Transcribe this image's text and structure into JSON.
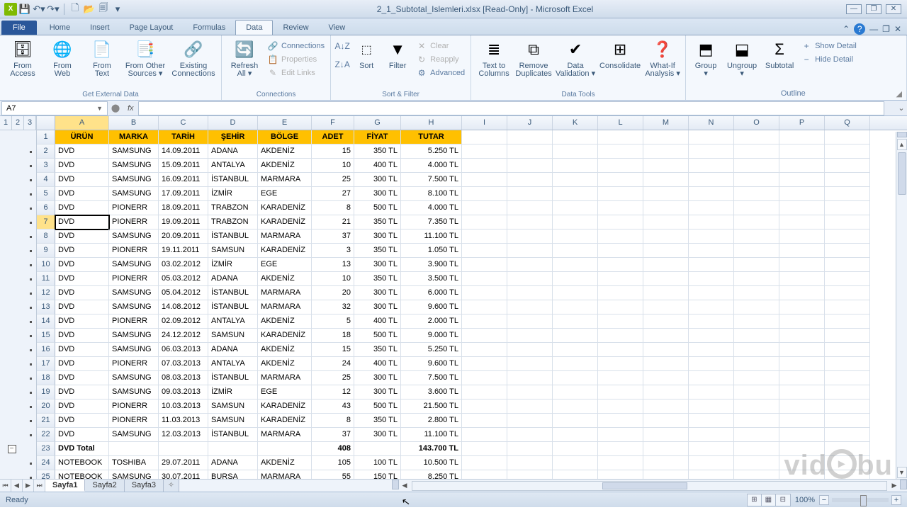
{
  "app": {
    "title": "2_1_Subtotal_Islemleri.xlsx  [Read-Only] - Microsoft Excel"
  },
  "tabs": {
    "file": "File",
    "home": "Home",
    "insert": "Insert",
    "pageLayout": "Page Layout",
    "formulas": "Formulas",
    "data": "Data",
    "review": "Review",
    "view": "View"
  },
  "ribbon": {
    "fromAccess": "From\nAccess",
    "fromWeb": "From\nWeb",
    "fromText": "From\nText",
    "fromOther": "From Other\nSources ▾",
    "existing": "Existing\nConnections",
    "getExternal": "Get External Data",
    "refresh": "Refresh\nAll ▾",
    "connections": "Connections",
    "properties": "Properties",
    "editLinks": "Edit Links",
    "connGroup": "Connections",
    "sort": "Sort",
    "filter": "Filter",
    "clear": "Clear",
    "reapply": "Reapply",
    "advanced": "Advanced",
    "sortFilter": "Sort & Filter",
    "textToCols": "Text to\nColumns",
    "removeDup": "Remove\nDuplicates",
    "dataVal": "Data\nValidation ▾",
    "consolidate": "Consolidate",
    "whatIf": "What-If\nAnalysis ▾",
    "dataTools": "Data Tools",
    "group": "Group\n▾",
    "ungroup": "Ungroup\n▾",
    "subtotal": "Subtotal",
    "showDetail": "Show Detail",
    "hideDetail": "Hide Detail",
    "outline": "Outline"
  },
  "namebox": "A7",
  "outlineLevels": [
    "1",
    "2",
    "3"
  ],
  "colLetters": [
    "A",
    "B",
    "C",
    "D",
    "E",
    "F",
    "G",
    "H",
    "I",
    "J",
    "K",
    "L",
    "M",
    "N",
    "O",
    "P",
    "Q"
  ],
  "headers": {
    "A": "ÜRÜN",
    "B": "MARKA",
    "C": "TARİH",
    "D": "ŞEHİR",
    "E": "BÖLGE",
    "F": "ADET",
    "G": "FİYAT",
    "H": "TUTAR"
  },
  "rows": [
    {
      "n": 2,
      "A": "DVD",
      "B": "SAMSUNG",
      "C": "14.09.2011",
      "D": "ADANA",
      "E": "AKDENİZ",
      "F": "15",
      "G": "350 TL",
      "H": "5.250 TL"
    },
    {
      "n": 3,
      "A": "DVD",
      "B": "SAMSUNG",
      "C": "15.09.2011",
      "D": "ANTALYA",
      "E": "AKDENİZ",
      "F": "10",
      "G": "400 TL",
      "H": "4.000 TL"
    },
    {
      "n": 4,
      "A": "DVD",
      "B": "SAMSUNG",
      "C": "16.09.2011",
      "D": "İSTANBUL",
      "E": "MARMARA",
      "F": "25",
      "G": "300 TL",
      "H": "7.500 TL"
    },
    {
      "n": 5,
      "A": "DVD",
      "B": "SAMSUNG",
      "C": "17.09.2011",
      "D": "İZMİR",
      "E": "EGE",
      "F": "27",
      "G": "300 TL",
      "H": "8.100 TL"
    },
    {
      "n": 6,
      "A": "DVD",
      "B": "PIONERR",
      "C": "18.09.2011",
      "D": "TRABZON",
      "E": "KARADENİZ",
      "F": "8",
      "G": "500 TL",
      "H": "4.000 TL"
    },
    {
      "n": 7,
      "A": "DVD",
      "B": "PIONERR",
      "C": "19.09.2011",
      "D": "TRABZON",
      "E": "KARADENİZ",
      "F": "21",
      "G": "350 TL",
      "H": "7.350 TL",
      "sel": true
    },
    {
      "n": 8,
      "A": "DVD",
      "B": "SAMSUNG",
      "C": "20.09.2011",
      "D": "İSTANBUL",
      "E": "MARMARA",
      "F": "37",
      "G": "300 TL",
      "H": "11.100 TL"
    },
    {
      "n": 9,
      "A": "DVD",
      "B": "PIONERR",
      "C": "19.11.2011",
      "D": "SAMSUN",
      "E": "KARADENİZ",
      "F": "3",
      "G": "350 TL",
      "H": "1.050 TL"
    },
    {
      "n": 10,
      "A": "DVD",
      "B": "SAMSUNG",
      "C": "03.02.2012",
      "D": "İZMİR",
      "E": "EGE",
      "F": "13",
      "G": "300 TL",
      "H": "3.900 TL"
    },
    {
      "n": 11,
      "A": "DVD",
      "B": "PIONERR",
      "C": "05.03.2012",
      "D": "ADANA",
      "E": "AKDENİZ",
      "F": "10",
      "G": "350 TL",
      "H": "3.500 TL"
    },
    {
      "n": 12,
      "A": "DVD",
      "B": "SAMSUNG",
      "C": "05.04.2012",
      "D": "İSTANBUL",
      "E": "MARMARA",
      "F": "20",
      "G": "300 TL",
      "H": "6.000 TL"
    },
    {
      "n": 13,
      "A": "DVD",
      "B": "SAMSUNG",
      "C": "14.08.2012",
      "D": "İSTANBUL",
      "E": "MARMARA",
      "F": "32",
      "G": "300 TL",
      "H": "9.600 TL"
    },
    {
      "n": 14,
      "A": "DVD",
      "B": "PIONERR",
      "C": "02.09.2012",
      "D": "ANTALYA",
      "E": "AKDENİZ",
      "F": "5",
      "G": "400 TL",
      "H": "2.000 TL"
    },
    {
      "n": 15,
      "A": "DVD",
      "B": "SAMSUNG",
      "C": "24.12.2012",
      "D": "SAMSUN",
      "E": "KARADENİZ",
      "F": "18",
      "G": "500 TL",
      "H": "9.000 TL"
    },
    {
      "n": 16,
      "A": "DVD",
      "B": "SAMSUNG",
      "C": "06.03.2013",
      "D": "ADANA",
      "E": "AKDENİZ",
      "F": "15",
      "G": "350 TL",
      "H": "5.250 TL"
    },
    {
      "n": 17,
      "A": "DVD",
      "B": "PIONERR",
      "C": "07.03.2013",
      "D": "ANTALYA",
      "E": "AKDENİZ",
      "F": "24",
      "G": "400 TL",
      "H": "9.600 TL"
    },
    {
      "n": 18,
      "A": "DVD",
      "B": "SAMSUNG",
      "C": "08.03.2013",
      "D": "İSTANBUL",
      "E": "MARMARA",
      "F": "25",
      "G": "300 TL",
      "H": "7.500 TL"
    },
    {
      "n": 19,
      "A": "DVD",
      "B": "SAMSUNG",
      "C": "09.03.2013",
      "D": "İZMİR",
      "E": "EGE",
      "F": "12",
      "G": "300 TL",
      "H": "3.600 TL"
    },
    {
      "n": 20,
      "A": "DVD",
      "B": "PIONERR",
      "C": "10.03.2013",
      "D": "SAMSUN",
      "E": "KARADENİZ",
      "F": "43",
      "G": "500 TL",
      "H": "21.500 TL"
    },
    {
      "n": 21,
      "A": "DVD",
      "B": "PIONERR",
      "C": "11.03.2013",
      "D": "SAMSUN",
      "E": "KARADENİZ",
      "F": "8",
      "G": "350 TL",
      "H": "2.800 TL"
    },
    {
      "n": 22,
      "A": "DVD",
      "B": "SAMSUNG",
      "C": "12.03.2013",
      "D": "İSTANBUL",
      "E": "MARMARA",
      "F": "37",
      "G": "300 TL",
      "H": "11.100 TL"
    },
    {
      "n": 23,
      "A": "DVD Total",
      "B": "",
      "C": "",
      "D": "",
      "E": "",
      "F": "408",
      "G": "",
      "H": "143.700 TL",
      "total": true
    },
    {
      "n": 24,
      "A": "NOTEBOOK",
      "B": "TOSHIBA",
      "C": "29.07.2011",
      "D": "ADANA",
      "E": "AKDENİZ",
      "F": "105",
      "G": "100 TL",
      "H": "10.500 TL"
    },
    {
      "n": 25,
      "A": "NOTEBOOK",
      "B": "SAMSUNG",
      "C": "30.07.2011",
      "D": "BURSA",
      "E": "MARMARA",
      "F": "55",
      "G": "150 TL",
      "H": "8.250 TL"
    }
  ],
  "sheets": {
    "s1": "Sayfa1",
    "s2": "Sayfa2",
    "s3": "Sayfa3"
  },
  "status": {
    "ready": "Ready",
    "zoom": "100%"
  },
  "watermark": "vid   bu"
}
